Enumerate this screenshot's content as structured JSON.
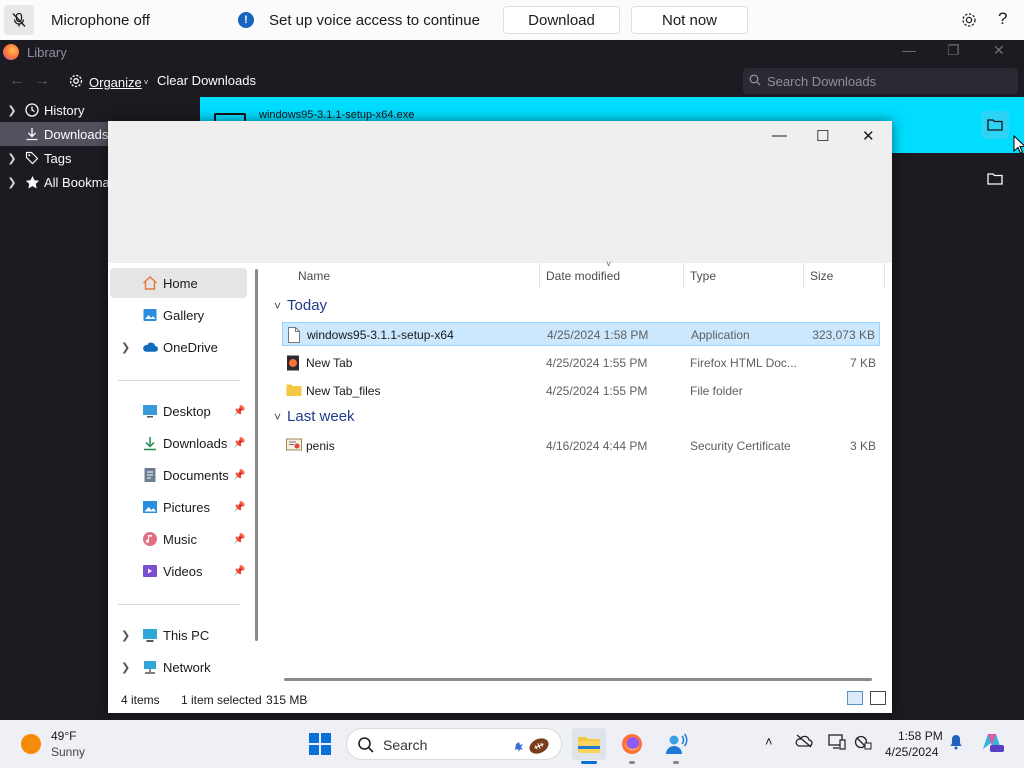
{
  "voice_bar": {
    "mic_label": "Microphone off",
    "info_text": "Set up voice access to continue",
    "download_label": "Download",
    "not_now_label": "Not now",
    "help_label": "?"
  },
  "library": {
    "title": "Library",
    "organize_label": "Organize",
    "clear_label": "Clear Downloads",
    "search_placeholder": "Search Downloads",
    "tree": [
      {
        "label": "History"
      },
      {
        "label": "Downloads"
      },
      {
        "label": "Tags"
      },
      {
        "label": "All Bookmarks"
      }
    ],
    "download_item": "windows95-3.1.1-setup-x64.exe"
  },
  "explorer": {
    "nav": {
      "home": "Home",
      "gallery": "Gallery",
      "onedrive": "OneDrive",
      "desktop": "Desktop",
      "downloads": "Downloads",
      "documents": "Documents",
      "pictures": "Pictures",
      "music": "Music",
      "videos": "Videos",
      "this_pc": "This PC",
      "network": "Network"
    },
    "columns": {
      "name": "Name",
      "date": "Date modified",
      "type": "Type",
      "size": "Size"
    },
    "groups": {
      "today": "Today",
      "last_week": "Last week"
    },
    "files": [
      {
        "name": "windows95-3.1.1-setup-x64",
        "date": "4/25/2024 1:58 PM",
        "type": "Application",
        "size": "323,073 KB"
      },
      {
        "name": "New Tab",
        "date": "4/25/2024 1:55 PM",
        "type": "Firefox HTML Doc...",
        "size": "7 KB"
      },
      {
        "name": "New Tab_files",
        "date": "4/25/2024 1:55 PM",
        "type": "File folder",
        "size": ""
      },
      {
        "name": "penis",
        "date": "4/16/2024 4:44 PM",
        "type": "Security Certificate",
        "size": "3 KB"
      }
    ],
    "status": {
      "count": "4 items",
      "selected": "1 item selected",
      "size": "315 MB"
    }
  },
  "taskbar": {
    "weather_temp": "49°F",
    "weather_cond": "Sunny",
    "search_label": "Search",
    "time": "1:58 PM",
    "date": "4/25/2024"
  },
  "colors": {
    "accent": "#00ddff",
    "selection": "#cce8ff",
    "start_blue": "#0a6fd8"
  }
}
